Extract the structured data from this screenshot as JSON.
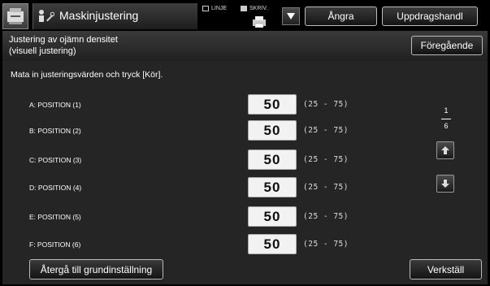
{
  "header": {
    "title": "Maskinjustering",
    "mode_line_label": "LINJE",
    "mode_print_label": "SKRIV.",
    "undo_label": "Ångra",
    "job_label": "Uppdragshandl"
  },
  "subheader": {
    "title_line1": "Justering av ojämn densitet",
    "title_line2": "(visuell justering)",
    "prev_label": "Föregående"
  },
  "main": {
    "instruction": "Mata in justeringsvärden och tryck [Kör].",
    "rows": [
      {
        "label": "A: POSITION  (1)",
        "value": "50",
        "range": "(25 - 75)"
      },
      {
        "label": "B: POSITION  (2)",
        "value": "50",
        "range": "(25 - 75)"
      },
      {
        "label": "C: POSITION  (3)",
        "value": "50",
        "range": "(25 - 75)"
      },
      {
        "label": "D: POSITION  (4)",
        "value": "50",
        "range": "(25 - 75)"
      },
      {
        "label": "E: POSITION  (5)",
        "value": "50",
        "range": "(25 - 75)"
      },
      {
        "label": "F: POSITION  (6)",
        "value": "50",
        "range": "(25 - 75)"
      }
    ],
    "page_current": "1",
    "page_total": "6",
    "reset_label": "Återgå till grundinställning",
    "run_label": "Verkställ"
  },
  "icons": {
    "app": "machine-adjust-icon",
    "title": "wrench-person-icon",
    "printer": "printer-icon",
    "dropdown": "triangle-down-icon",
    "up": "arrow-up-icon",
    "down": "arrow-down-icon"
  }
}
